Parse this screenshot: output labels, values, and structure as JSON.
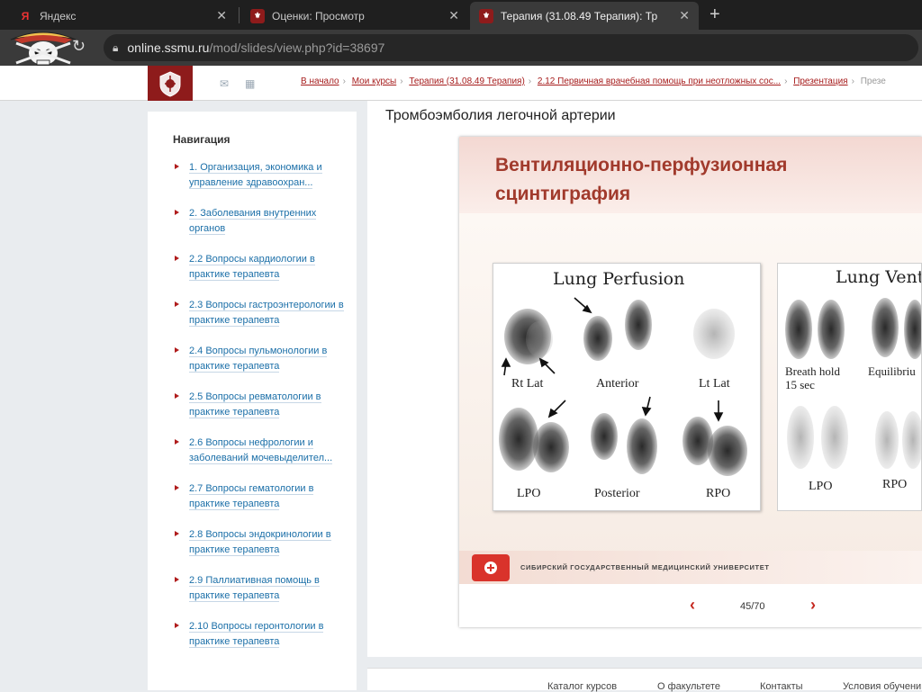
{
  "browser": {
    "tabs": [
      {
        "label": "Яндекс",
        "icon": "yandex-icon"
      },
      {
        "label": "Оценки: Просмотр",
        "icon": "ssmu-icon"
      },
      {
        "label": "Терапия (31.08.49 Терапия): Тр",
        "icon": "ssmu-icon"
      }
    ],
    "url_host": "online.ssmu.ru",
    "url_path": "/mod/slides/view.php?id=38697"
  },
  "breadcrumb": [
    "В начало",
    "Мои курсы",
    "Терапия (31.08.49 Терапия)",
    "2.12 Первичная врачебная помощь при неотложных сос...",
    "Презентация",
    "Презе"
  ],
  "nav": {
    "title": "Навигация",
    "items": [
      "1. Организация, экономика и управление здравоохран...",
      "2. Заболевания внутренних органов",
      "2.2 Вопросы кардиологии в практике терапевта",
      "2.3 Вопросы гастроэнтерологии в практике терапевта",
      "2.4 Вопросы пульмонологии в практике терапевта",
      "2.5 Вопросы ревматологии в практике терапевта",
      "2.6 Вопросы нефрологии и заболеваний мочевыделител...",
      "2.7 Вопросы гематологии в практике терапевта",
      "2.8 Вопросы эндокринологии в практике терапевта",
      "2.9 Паллиативная помощь в практике терапевта",
      "2.10 Вопросы геронтологии в практике терапевта"
    ]
  },
  "page_title": "Тромбоэмболия легочной артерии",
  "slide": {
    "title_line1": "Вентиляционно-перфузионная",
    "title_line2": "сцинтиграфия",
    "perfusion": {
      "title": "Lung Perfusion",
      "labels": [
        "Rt Lat",
        "Anterior",
        "Lt Lat",
        "LPO",
        "Posterior",
        "RPO"
      ]
    },
    "ventilation": {
      "title": "Lung Venti",
      "labels": [
        "Breath hold",
        "15 sec",
        "Equilibriu",
        "LPO",
        "RPO"
      ]
    },
    "university": "Сибирский государственный медицинский университет"
  },
  "pager": {
    "text": "45/70",
    "prev_icon": "chevron-left-icon",
    "next_icon": "chevron-right-icon"
  },
  "footer": {
    "links": [
      "Каталог курсов",
      "О факультете",
      "Контакты",
      "Условия обучени"
    ]
  }
}
